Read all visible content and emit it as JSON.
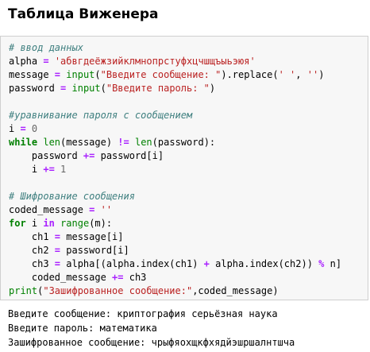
{
  "title": "Таблица Виженера",
  "code_lines": [
    [
      {
        "t": "# ввод данных",
        "c": "cm"
      }
    ],
    [
      {
        "t": "alpha ",
        "c": ""
      },
      {
        "t": "=",
        "c": "op"
      },
      {
        "t": " ",
        "c": ""
      },
      {
        "t": "'абвгдеёжзийклмнопрстуфхцчшщъыьэюя'",
        "c": "st"
      }
    ],
    [
      {
        "t": "message ",
        "c": ""
      },
      {
        "t": "=",
        "c": "op"
      },
      {
        "t": " ",
        "c": ""
      },
      {
        "t": "input",
        "c": "bi"
      },
      {
        "t": "(",
        "c": ""
      },
      {
        "t": "\"Введите сообщение: \"",
        "c": "st"
      },
      {
        "t": ").replace(",
        "c": ""
      },
      {
        "t": "' '",
        "c": "st"
      },
      {
        "t": ", ",
        "c": ""
      },
      {
        "t": "''",
        "c": "st"
      },
      {
        "t": ")",
        "c": ""
      }
    ],
    [
      {
        "t": "password ",
        "c": ""
      },
      {
        "t": "=",
        "c": "op"
      },
      {
        "t": " ",
        "c": ""
      },
      {
        "t": "input",
        "c": "bi"
      },
      {
        "t": "(",
        "c": ""
      },
      {
        "t": "\"Введите пароль: \"",
        "c": "st"
      },
      {
        "t": ")",
        "c": ""
      }
    ],
    [
      {
        "t": "",
        "c": ""
      }
    ],
    [
      {
        "t": "#уравнивание пароля с сообщением",
        "c": "cm"
      }
    ],
    [
      {
        "t": "i ",
        "c": ""
      },
      {
        "t": "=",
        "c": "op"
      },
      {
        "t": " ",
        "c": ""
      },
      {
        "t": "0",
        "c": "nu"
      }
    ],
    [
      {
        "t": "while",
        "c": "kw"
      },
      {
        "t": " ",
        "c": ""
      },
      {
        "t": "len",
        "c": "bi"
      },
      {
        "t": "(message) ",
        "c": ""
      },
      {
        "t": "!=",
        "c": "op"
      },
      {
        "t": " ",
        "c": ""
      },
      {
        "t": "len",
        "c": "bi"
      },
      {
        "t": "(password):",
        "c": ""
      }
    ],
    [
      {
        "t": "    password ",
        "c": ""
      },
      {
        "t": "+=",
        "c": "op"
      },
      {
        "t": " password[i]",
        "c": ""
      }
    ],
    [
      {
        "t": "    i ",
        "c": ""
      },
      {
        "t": "+=",
        "c": "op"
      },
      {
        "t": " ",
        "c": ""
      },
      {
        "t": "1",
        "c": "nu"
      }
    ],
    [
      {
        "t": "",
        "c": ""
      }
    ],
    [
      {
        "t": "# Шифрование сообщения",
        "c": "cm"
      }
    ],
    [
      {
        "t": "coded_message ",
        "c": ""
      },
      {
        "t": "=",
        "c": "op"
      },
      {
        "t": " ",
        "c": ""
      },
      {
        "t": "''",
        "c": "st"
      }
    ],
    [
      {
        "t": "for",
        "c": "kw"
      },
      {
        "t": " i ",
        "c": ""
      },
      {
        "t": "in",
        "c": "op"
      },
      {
        "t": " ",
        "c": ""
      },
      {
        "t": "range",
        "c": "bi"
      },
      {
        "t": "(m):",
        "c": ""
      }
    ],
    [
      {
        "t": "    ch1 ",
        "c": ""
      },
      {
        "t": "=",
        "c": "op"
      },
      {
        "t": " message[i]",
        "c": ""
      }
    ],
    [
      {
        "t": "    ch2 ",
        "c": ""
      },
      {
        "t": "=",
        "c": "op"
      },
      {
        "t": " password[i]",
        "c": ""
      }
    ],
    [
      {
        "t": "    ch3 ",
        "c": ""
      },
      {
        "t": "=",
        "c": "op"
      },
      {
        "t": " alpha[(alpha.index(ch1) ",
        "c": ""
      },
      {
        "t": "+",
        "c": "op"
      },
      {
        "t": " alpha.index(ch2)) ",
        "c": ""
      },
      {
        "t": "%",
        "c": "op"
      },
      {
        "t": " n]",
        "c": ""
      }
    ],
    [
      {
        "t": "    coded_message ",
        "c": ""
      },
      {
        "t": "+=",
        "c": "op"
      },
      {
        "t": " ch3",
        "c": ""
      }
    ],
    [
      {
        "t": "print",
        "c": "bi"
      },
      {
        "t": "(",
        "c": ""
      },
      {
        "t": "\"Зашифрованное сообщение:\"",
        "c": "st"
      },
      {
        "t": ",coded_message)",
        "c": ""
      }
    ]
  ],
  "output_lines": [
    "Введите сообщение: криптография серьёзная наука",
    "Введите пароль: математика",
    "Зашифрованное сообщение: чрыфяохщкфхядйэшршалнтшча"
  ]
}
